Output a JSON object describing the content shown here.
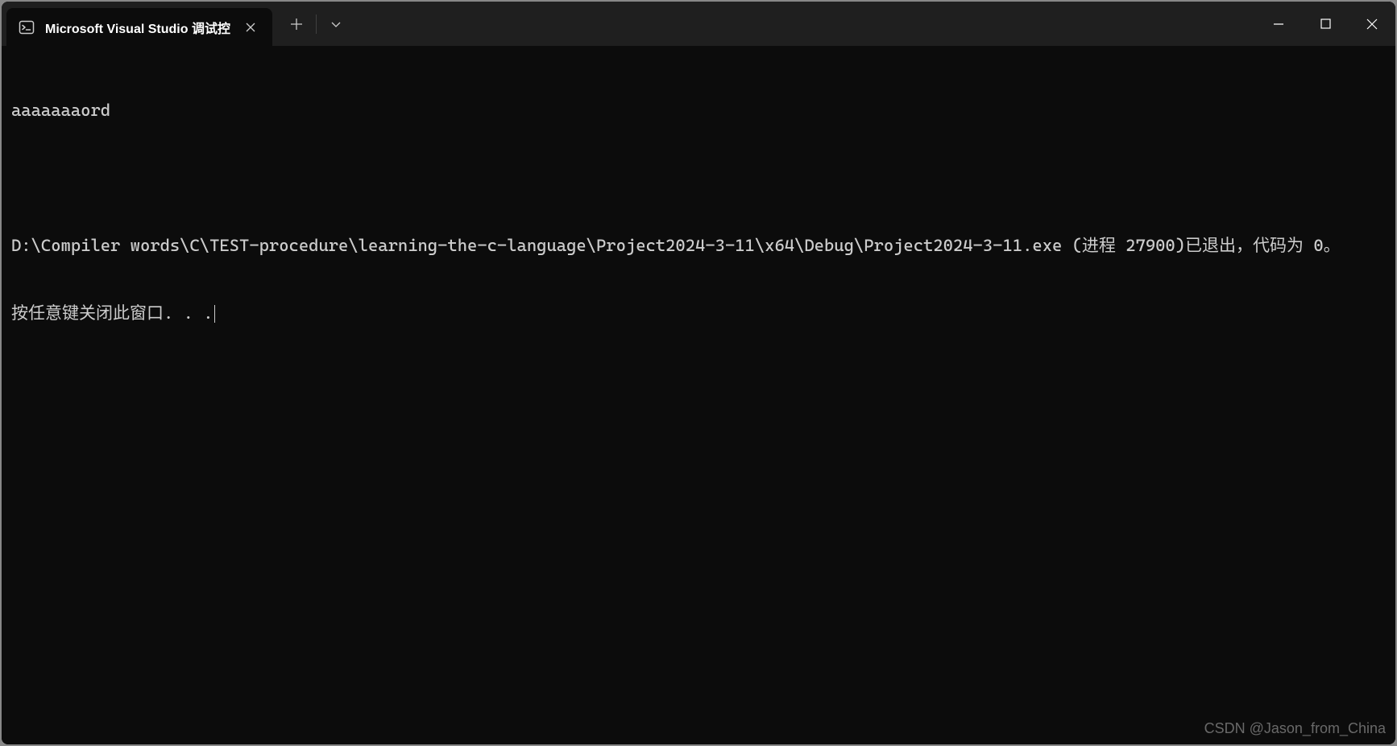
{
  "tab": {
    "title": "Microsoft Visual Studio 调试控"
  },
  "terminal": {
    "line1": "aaaaaaaord",
    "line2": "D:\\Compiler words\\C\\TEST-procedure\\learning-the-c-language\\Project2024-3-11\\x64\\Debug\\Project2024-3-11.exe (进程 27900)已退出，代码为 0。",
    "line3": "按任意键关闭此窗口. . ."
  },
  "watermark": "CSDN @Jason_from_China"
}
